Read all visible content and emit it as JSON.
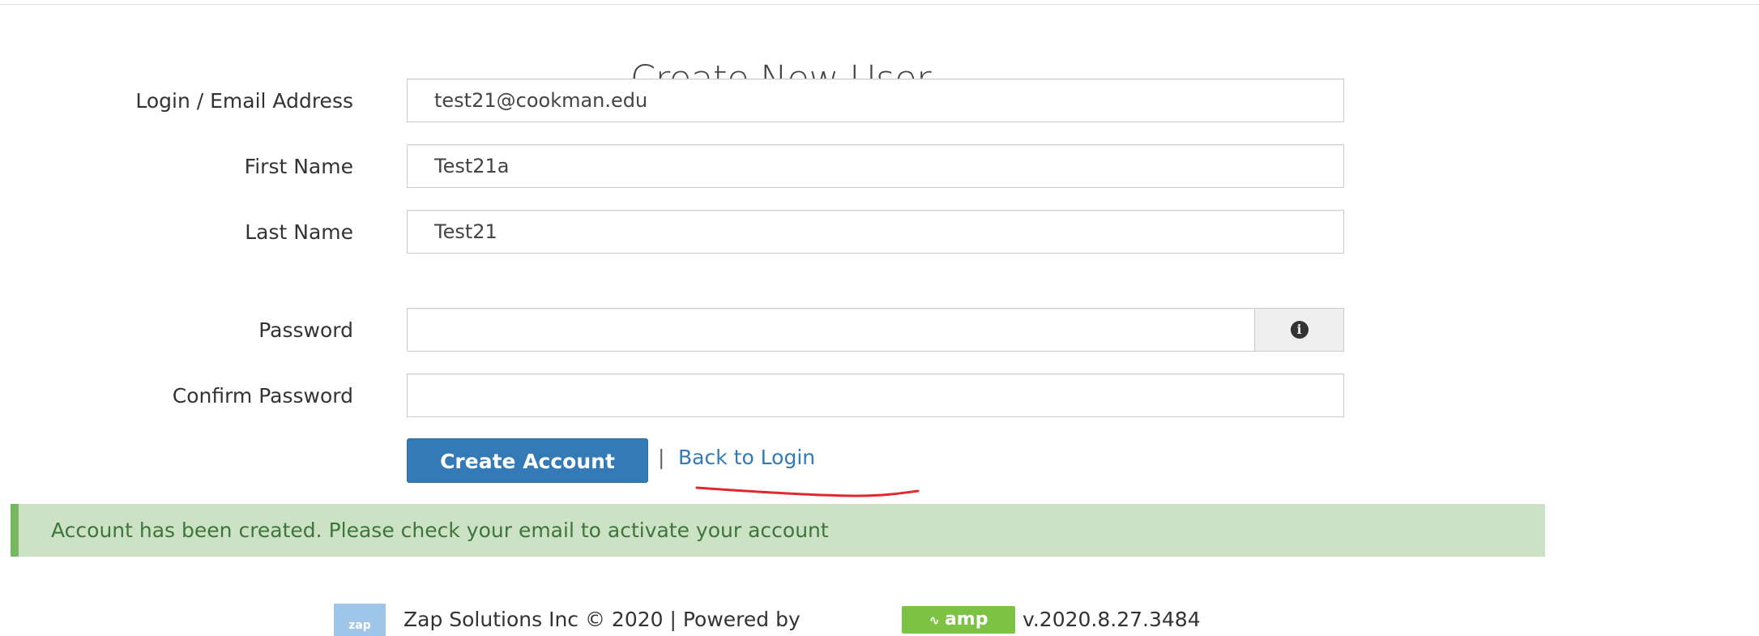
{
  "page": {
    "title": "Create New User"
  },
  "form": {
    "email": {
      "label": "Login / Email Address",
      "value": "test21@cookman.edu"
    },
    "first_name": {
      "label": "First Name",
      "value": "Test21a"
    },
    "last_name": {
      "label": "Last Name",
      "value": "Test21"
    },
    "password": {
      "label": "Password",
      "value": "",
      "addon_icon": "info-circle-icon"
    },
    "confirm_password": {
      "label": "Confirm Password",
      "value": ""
    },
    "submit_label": "Create Account",
    "separator": "|",
    "back_link_label": "Back to Login"
  },
  "alert": {
    "message": "Account has been created. Please check your email to activate your account"
  },
  "footer": {
    "zap_logo_text": "zap",
    "company_text": "Zap Solutions Inc © 2020 | Powered by",
    "amp_logo_text": "amp",
    "version": "v.2020.8.27.3484"
  },
  "colors": {
    "primary": "#337ab7",
    "alert_bg": "#cde1c4",
    "alert_border": "#76b760",
    "alert_text": "#3c763d",
    "amp_green": "#7cc243",
    "annotation_red": "#e0282e"
  }
}
